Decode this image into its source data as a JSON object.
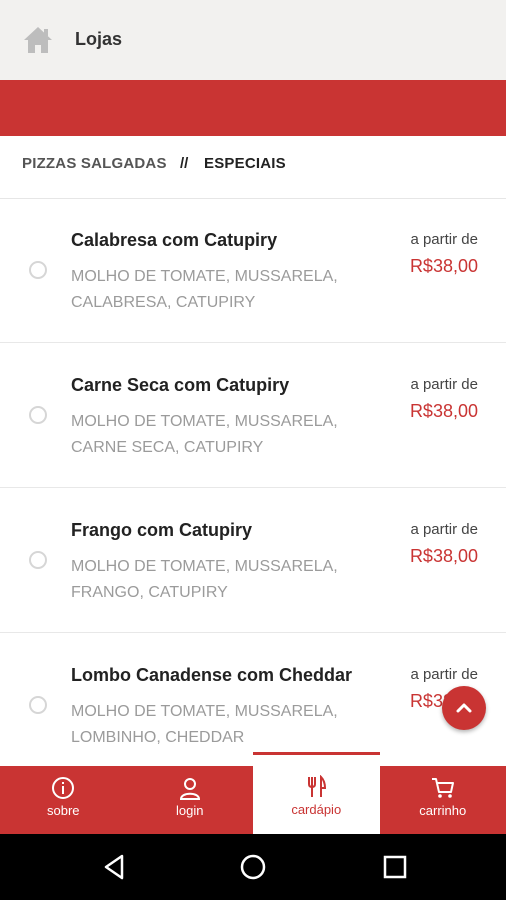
{
  "header": {
    "title": "Lojas",
    "icon": "home-icon"
  },
  "breadcrumb": {
    "category": "PIZZAS SALGADAS",
    "separator": "//",
    "subcategory": "ESPECIAIS"
  },
  "products": [
    {
      "name": "Calabresa com Catupiry",
      "description": "MOLHO DE TOMATE, MUSSARELA, CALABRESA, CATUPIRY",
      "price_prefix": "a partir de",
      "price": "R$38,00"
    },
    {
      "name": "Carne Seca com Catupiry",
      "description": "MOLHO DE TOMATE, MUSSARELA, CARNE SECA, CATUPIRY",
      "price_prefix": "a partir de",
      "price": "R$38,00"
    },
    {
      "name": "Frango com Catupiry",
      "description": "MOLHO DE TOMATE, MUSSARELA, FRANGO, CATUPIRY",
      "price_prefix": "a partir de",
      "price": "R$38,00"
    },
    {
      "name": "Lombo Canadense com Cheddar",
      "description": "MOLHO DE TOMATE, MUSSARELA, LOMBINHO, CHEDDAR",
      "price_prefix": "a partir de",
      "price": "R$38,00"
    }
  ],
  "tabs": [
    {
      "label": "sobre",
      "icon": "info-icon"
    },
    {
      "label": "login",
      "icon": "user-icon"
    },
    {
      "label": "cardápio",
      "icon": "cutlery-icon",
      "active": true
    },
    {
      "label": "carrinho",
      "icon": "cart-icon"
    }
  ],
  "colors": {
    "accent": "#c93433",
    "topbar": "#f2f1ef",
    "muted_text": "#9b9b9b"
  }
}
